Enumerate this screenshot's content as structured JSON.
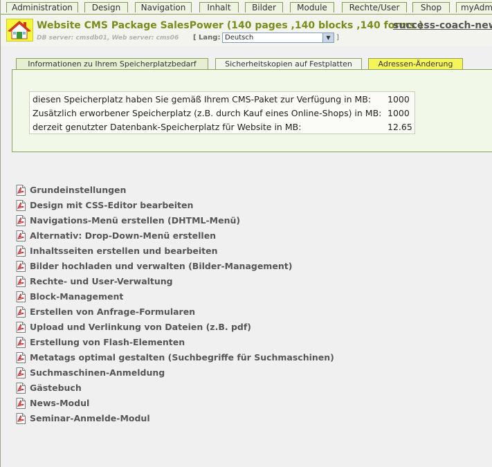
{
  "topnav": {
    "tabs": [
      "Administration",
      "Design",
      "Navigation",
      "Inhalt",
      "Bilder",
      "Module",
      "Rechte/User",
      "Shop",
      "myAdm"
    ]
  },
  "header": {
    "title": "Website CMS Package SalesPower (140 pages ,140 blocks ,140 forms )",
    "site_link": "success-coach-new",
    "db_info": "DB server: cmsdb01, Web server: cms06",
    "lang_label": "[ Lang:",
    "lang_value": "Deutsch",
    "lang_close": "]"
  },
  "tabs": [
    {
      "label": "Informationen zu Ihrem Speicherplatzbedarf"
    },
    {
      "label": "Sicherheitskopien auf Festplatten"
    },
    {
      "label": "Adressen-Änderung"
    }
  ],
  "storage": {
    "rows": [
      {
        "label": "diesen Speicherplatz haben Sie gemäß Ihrem CMS-Paket zur Verfügung in MB:",
        "value": "1000"
      },
      {
        "label": "Zusätzlich erworbener Speicherplatz (z.B. durch Kauf eines Online-Shops) in MB:",
        "value": "1000"
      },
      {
        "label": "derzeit genutzter Datenbank-Speicherplatz für Website in MB:",
        "value": "12.65"
      }
    ]
  },
  "docs": {
    "items": [
      "Grundeinstellungen",
      "Design mit CSS-Editor bearbeiten",
      "Navigations-Menü erstellen (DHTML-Menü)",
      "Alternativ: Drop-Down-Menü erstellen",
      "Inhaltsseiten erstellen und bearbeiten",
      "Bilder hochladen und verwalten (Bilder-Management)",
      "Rechte- und User-Verwaltung",
      "Block-Management",
      "Erstellen von Anfrage-Formularen",
      "Upload und Verlinkung von Dateien (z.B. pdf)",
      "Erstellung von Flash-Elementen",
      "Metatags optimal gestalten (Suchbegriffe für Suchmaschinen)",
      "Suchmaschinen-Anmeldung",
      "Gästebuch",
      "News-Modul",
      "Seminar-Anmelde-Modul"
    ]
  },
  "colors": {
    "accent_green": "#7a8c1a",
    "highlight_yellow": "#f5f55a",
    "border_green": "#8aa05a"
  }
}
